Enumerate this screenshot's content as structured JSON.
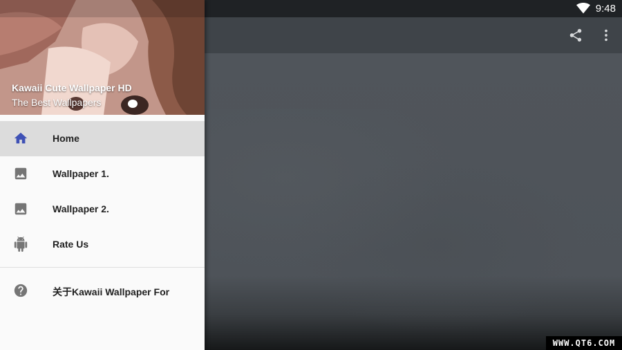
{
  "status_bar": {
    "time": "9:48",
    "wifi_icon": "wifi-icon"
  },
  "toolbar": {
    "share_icon": "share-icon",
    "more_icon": "more-vert-icon"
  },
  "drawer": {
    "header": {
      "title": "Kawaii Cute Wallpaper HD",
      "subtitle": "The Best Wallpapers"
    },
    "items": [
      {
        "label": "Home",
        "icon": "home-icon",
        "active": true
      },
      {
        "label": "Wallpaper 1.",
        "icon": "image-icon"
      },
      {
        "label": "Wallpaper 2.",
        "icon": "image-icon"
      },
      {
        "label": "Rate Us",
        "icon": "android-icon"
      }
    ],
    "about": {
      "label": "关于Kawaii Wallpaper For",
      "icon": "help-circle-icon"
    }
  },
  "colors": {
    "accent": "#3f51b5",
    "icon_gray": "#757575",
    "active_bg": "#dcdcdc"
  },
  "watermark": "WWW.QT6.COM"
}
